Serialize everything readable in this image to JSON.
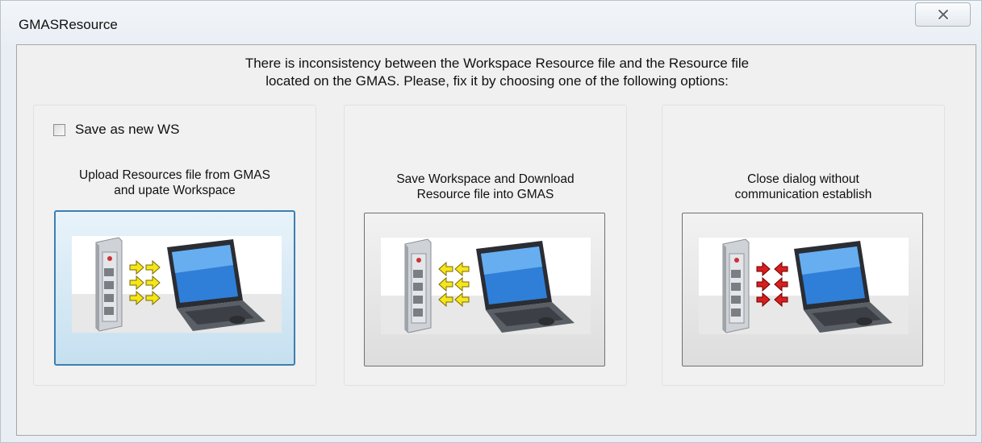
{
  "window": {
    "title": "GMASResource",
    "close_icon": "close-x-icon"
  },
  "message": {
    "line1": "There is inconsistency between the Workspace Resource file and the Resource file",
    "line2": "located on the GMAS. Please, fix it by choosing one of the following options:"
  },
  "panels": [
    {
      "checkbox_label": "Save as new WS",
      "checkbox_checked": false,
      "desc_line1": "Upload Resources file from GMAS",
      "desc_line2": "and upate Workspace",
      "icon": "gmas-to-laptop-icon",
      "arrow_color": "#f5e61a",
      "arrow_direction": "right"
    },
    {
      "desc_line1": "Save Workspace and Download",
      "desc_line2": "Resource file into GMAS",
      "icon": "laptop-to-gmas-icon",
      "arrow_color": "#f5e61a",
      "arrow_direction": "left"
    },
    {
      "desc_line1": "Close dialog without",
      "desc_line2": "communication establish",
      "icon": "no-communication-icon",
      "arrow_color": "#d91e1e",
      "arrow_direction": "opposed"
    }
  ]
}
